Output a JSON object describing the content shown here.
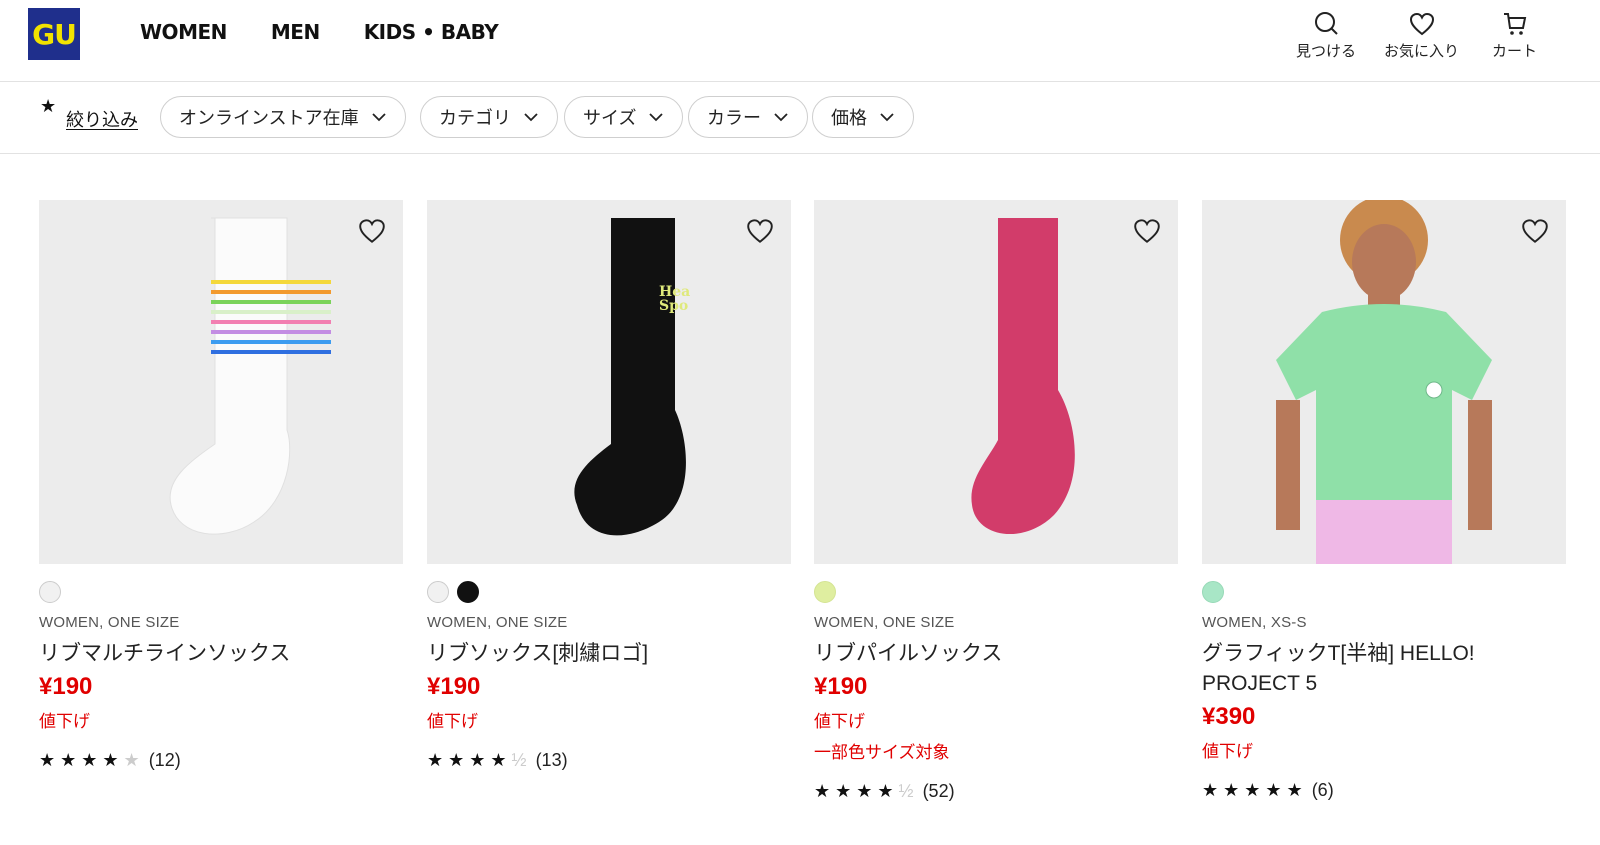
{
  "brand": {
    "logo_text": "GU",
    "logo_bg": "#1f2f8c",
    "logo_fg": "#f2e300"
  },
  "nav": [
    {
      "label": "WOMEN"
    },
    {
      "label": "MEN"
    },
    {
      "label": "KIDS • BABY"
    }
  ],
  "utility": {
    "search_label": "見つける",
    "favorites_label": "お気に入り",
    "cart_label": "カート"
  },
  "filters": {
    "filter_link": "絞り込み",
    "chips": [
      {
        "label": "オンラインストア在庫"
      },
      {
        "label": "カテゴリ"
      },
      {
        "label": "サイズ"
      },
      {
        "label": "カラー"
      },
      {
        "label": "価格"
      }
    ]
  },
  "products": [
    {
      "meta": "WOMEN, ONE SIZE",
      "name": "リブマルチラインソックス",
      "price": "¥190",
      "tags": [
        "値下げ"
      ],
      "swatches": [
        "#f1f1f1"
      ],
      "stars": 4,
      "review_count": "(12)"
    },
    {
      "meta": "WOMEN, ONE SIZE",
      "name": "リブソックス[刺繍ロゴ]",
      "price": "¥190",
      "tags": [
        "値下げ"
      ],
      "swatches": [
        "#f1f1f1",
        "#111111"
      ],
      "stars": 4.5,
      "review_count": "(13)"
    },
    {
      "meta": "WOMEN, ONE SIZE",
      "name": "リブパイルソックス",
      "price": "¥190",
      "tags": [
        "値下げ",
        "一部色サイズ対象"
      ],
      "swatches": [
        "#dfeea0"
      ],
      "stars": 4.5,
      "review_count": "(52)"
    },
    {
      "meta": "WOMEN, XS-S",
      "name": "グラフィックT[半袖] HELLO! PROJECT 5",
      "price": "¥390",
      "tags": [
        "値下げ"
      ],
      "swatches": [
        "#a8e6c6"
      ],
      "stars": 5,
      "review_count": "(6)"
    }
  ],
  "colors": {
    "sale_red": "#e00000",
    "image_bg": "#ececec"
  }
}
